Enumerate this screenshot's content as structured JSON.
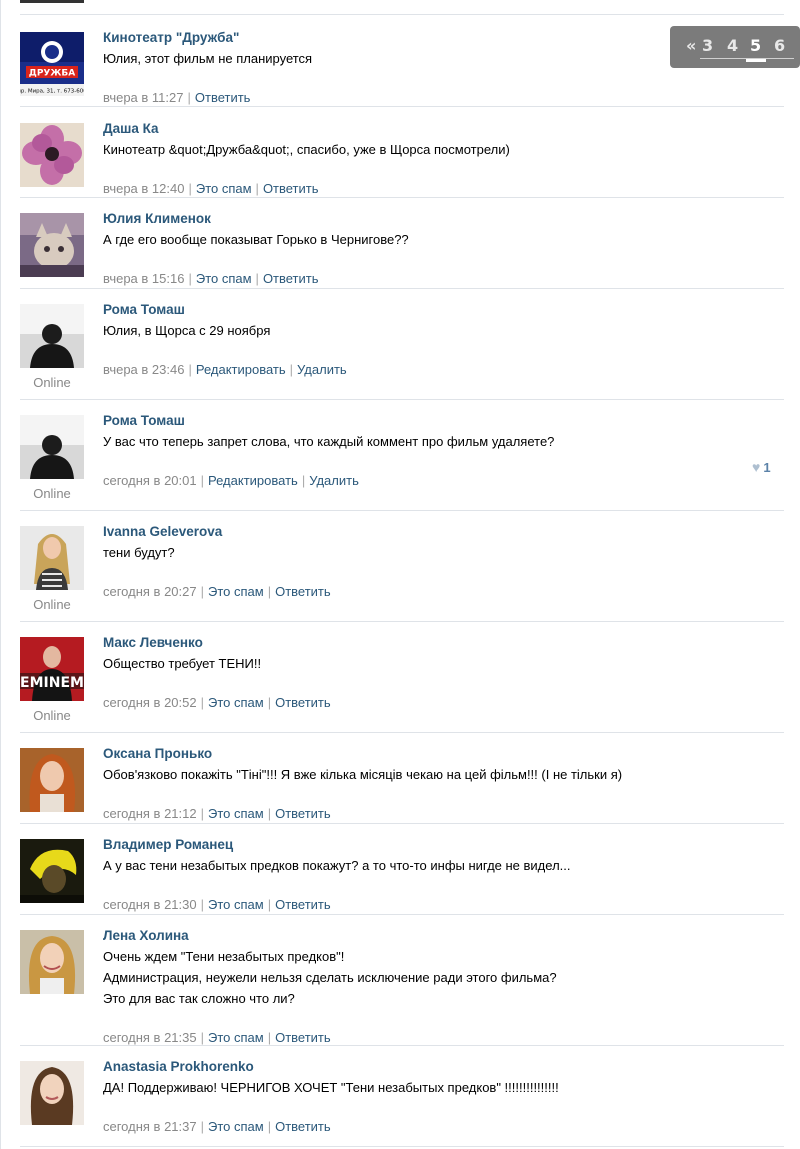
{
  "pager": {
    "prev": "«",
    "pages": [
      "3",
      "4",
      "5",
      "6"
    ],
    "current": "5"
  },
  "like_count": "1",
  "posts": [
    {
      "author": "Кинотеатр \"Дружба\"",
      "lines": [
        "Юлия, этот фильм не планируется"
      ],
      "date": "вчера в 11:27",
      "actions": [
        "Ответить"
      ],
      "online": ""
    },
    {
      "author": "Даша Ка",
      "lines": [
        "Кинотеатр &quot;Дружба&quot;, спасибо, уже в Щорса посмотрели)"
      ],
      "date": "вчера в 12:40",
      "actions": [
        "Это спам",
        "Ответить"
      ],
      "online": ""
    },
    {
      "author": "Юлия Клименок",
      "lines": [
        "А где его вообще показыват Горько в Чернигове??"
      ],
      "date": "вчера в 15:16",
      "actions": [
        "Это спам",
        "Ответить"
      ],
      "online": ""
    },
    {
      "author": "Рома Томаш",
      "lines": [
        "Юлия, в Щорса с 29 ноября"
      ],
      "date": "вчера в 23:46",
      "actions": [
        "Редактировать",
        "Удалить"
      ],
      "online": "Online"
    },
    {
      "author": "Рома Томаш",
      "lines": [
        "У вас что теперь запрет слова, что каждый коммент про фильм удаляете?"
      ],
      "date": "сегодня в 20:01",
      "actions": [
        "Редактировать",
        "Удалить"
      ],
      "online": "Online"
    },
    {
      "author": "Ivanna Geleverova",
      "lines": [
        "тени будут?"
      ],
      "date": "сегодня в 20:27",
      "actions": [
        "Это спам",
        "Ответить"
      ],
      "online": "Online"
    },
    {
      "author": "Макс Левченко",
      "lines": [
        "Общество требует ТЕНИ!!"
      ],
      "date": "сегодня в 20:52",
      "actions": [
        "Это спам",
        "Ответить"
      ],
      "online": "Online"
    },
    {
      "author": "Оксана Пронько",
      "lines": [
        "Обов'язково покажіть \"Тіні\"!!! Я вже кілька місяців чекаю на цей фільм!!! (І не тільки я)"
      ],
      "date": "сегодня в 21:12",
      "actions": [
        "Это спам",
        "Ответить"
      ],
      "online": ""
    },
    {
      "author": "Владимер Романец",
      "lines": [
        "А у вас тени незабытых предков покажут? а то что-то инфы нигде не видел..."
      ],
      "date": "сегодня в 21:30",
      "actions": [
        "Это спам",
        "Ответить"
      ],
      "online": ""
    },
    {
      "author": "Лена Холина",
      "lines": [
        "Очень ждем \"Тени незабытых предков\"!",
        "Администрация, неужели нельзя сделать исключение ради этого фильма?",
        "Это для вас так сложно что ли?"
      ],
      "date": "сегодня в 21:35",
      "actions": [
        "Это спам",
        "Ответить"
      ],
      "online": ""
    },
    {
      "author": "Anastasia Prokhorenko",
      "lines": [
        "ДА! Поддерживаю! ЧЕРНИГОВ ХОЧЕТ \"Тени незабытых предков\" !!!!!!!!!!!!!!!"
      ],
      "date": "сегодня в 21:37",
      "actions": [
        "Это спам",
        "Ответить"
      ],
      "online": ""
    }
  ],
  "avatar_logo_text": "ДРУЖБА",
  "avatar_logo_address": "пр. Мира, 31, т. 673-600",
  "avatar_eminem_text": "EMINEM",
  "colors": {
    "link": "#2b587a",
    "meta": "#888888",
    "divider": "#dfe3e8",
    "pager_bg": "#7b7b7b"
  }
}
